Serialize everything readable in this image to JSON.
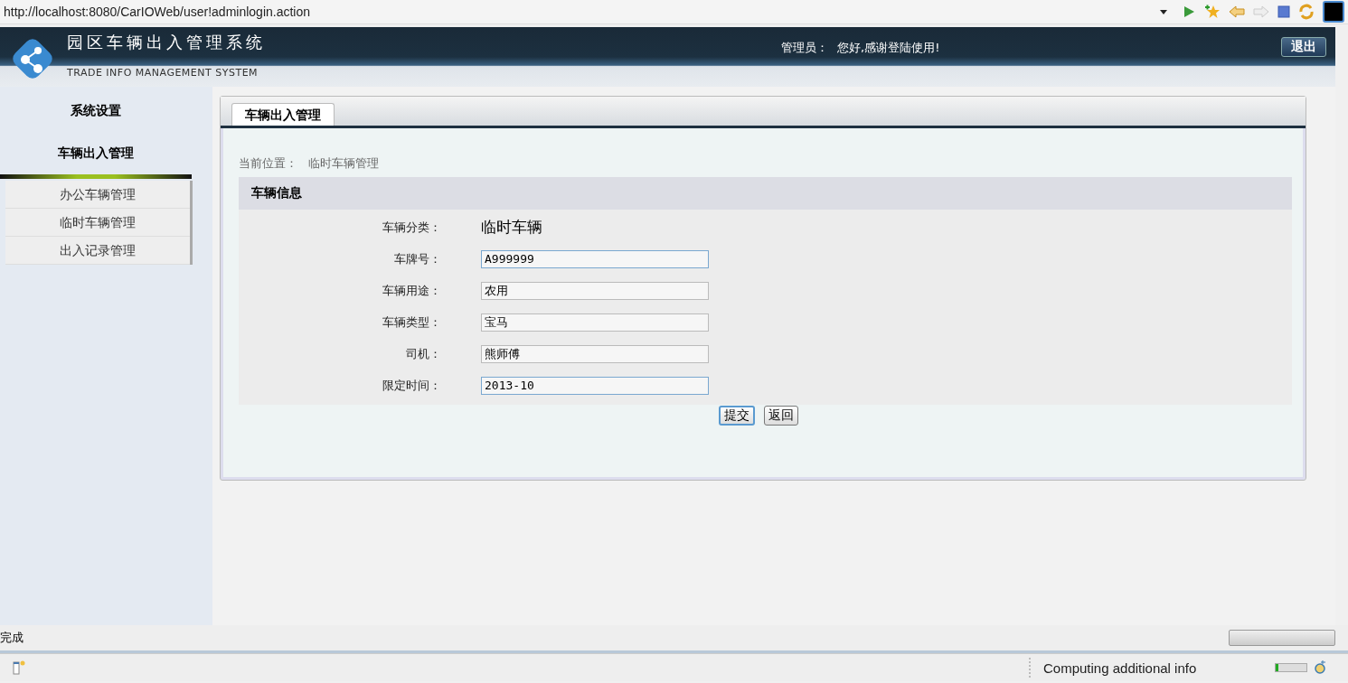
{
  "address_bar": {
    "url": "http://localhost:8080/CarIOWeb/user!adminlogin.action"
  },
  "header": {
    "title": "园区车辆出入管理系统",
    "subtitle": "TRADE INFO MANAGEMENT SYSTEM",
    "admin_label": "管理员：",
    "greeting": "您好,感谢登陆使用!",
    "logout": "退出"
  },
  "sidebar": {
    "sections": [
      {
        "label": "系统设置",
        "expanded": false
      },
      {
        "label": "车辆出入管理",
        "expanded": true,
        "items": [
          {
            "label": "办公车辆管理",
            "selected": false
          },
          {
            "label": "临时车辆管理",
            "selected": false
          },
          {
            "label": "出入记录管理",
            "selected": false
          }
        ]
      }
    ]
  },
  "tabs": [
    {
      "label": "车辆出入管理",
      "selected": true
    }
  ],
  "breadcrumb": {
    "label": "当前位置：",
    "value": "临时车辆管理"
  },
  "form": {
    "title": "车辆信息",
    "fields": [
      {
        "kind": "text",
        "label": "车辆分类：",
        "value": "临时车辆"
      },
      {
        "kind": "input",
        "label": "车牌号：",
        "value": "A999999",
        "focused": true
      },
      {
        "kind": "input",
        "label": "车辆用途：",
        "value": "农用",
        "focused": false
      },
      {
        "kind": "input",
        "label": "车辆类型：",
        "value": "宝马",
        "focused": false
      },
      {
        "kind": "input",
        "label": "司机：",
        "value": "熊师傅",
        "focused": false
      },
      {
        "kind": "input",
        "label": "限定时间：",
        "value": "2013-10",
        "focused": true
      }
    ],
    "buttons": [
      {
        "label": "提交",
        "kind": "primary"
      },
      {
        "label": "返回",
        "kind": "normal"
      }
    ]
  },
  "status_bar": {
    "text": "完成",
    "progress": {
      "level": 0
    }
  },
  "bottom_bar": {
    "text": "Computing additional info",
    "progress": {
      "level": 0.1
    }
  }
}
